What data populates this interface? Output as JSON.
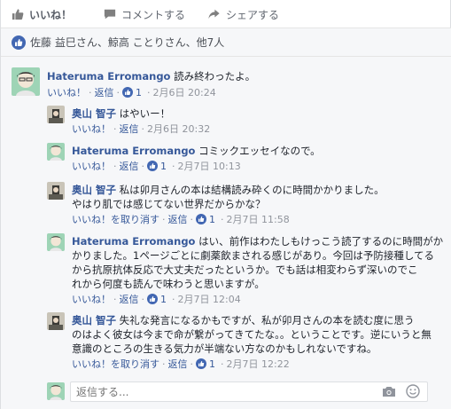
{
  "actions": {
    "like_label": "いいね！",
    "comment_label": "コメントする",
    "share_label": "シェアする"
  },
  "summary": {
    "text": "佐藤 益巳さん、鯨高 ことりさん、他7人"
  },
  "comments": [
    {
      "author": "Hateruma Erromango",
      "text": "読み終わったよ。",
      "like_label": "いいね！",
      "reply_label": "返信",
      "like_count": "1",
      "time": "2月6日 20:24"
    },
    {
      "author": "奥山 智子",
      "text": "はやいー！",
      "like_label": "いいね！",
      "reply_label": "返信",
      "time": "2月6日 20:32"
    },
    {
      "author": "Hateruma Erromango",
      "text": "コミックエッセイなので。",
      "like_label": "いいね！",
      "reply_label": "返信",
      "like_count": "1",
      "time": "2月7日 10:13"
    },
    {
      "author": "奥山 智子",
      "text_line1": "私は卯月さんの本は結構読み砕くのに時間かかりました。",
      "text_line2": "やはり肌では感じてない世界だからかな？",
      "like_label": "いいね！を取り消す",
      "reply_label": "返信",
      "like_count": "1",
      "time": "2月7日 11:58"
    },
    {
      "author": "Hateruma Erromango",
      "text_line1": "はい、前作はわたしもけっこう読了するのに時間がか",
      "text_line2": "かりました。1ページごとに劇薬飲まされる感じがあり。今回は予防接種してる",
      "text_line3": "から抗原抗体反応で大丈夫だったというか。でも話は相変わらず深いのでこ",
      "text_line4": "れから何度も読んで味わうと思いますが。",
      "like_label": "いいね！",
      "reply_label": "返信",
      "like_count": "1",
      "time": "2月7日 12:04"
    },
    {
      "author": "奥山 智子",
      "text_line1": "失礼な発言になるかもですが、私が卯月さんの本を読む度に思う",
      "text_line2": "のはよく彼女は今まで命が繋がってきてたな。。ということです。逆にいうと無",
      "text_line3": "意識のところの生きる気力が半端ない方なのかもしれないですね。",
      "like_label": "いいね！を取り消す",
      "reply_label": "返信",
      "like_count": "1",
      "time": "2月7日 12:22"
    }
  ],
  "reply_input": {
    "placeholder": "返信する..."
  },
  "colors": {
    "link": "#365899",
    "like_blue": "#4267b2",
    "meta_gray": "#90949c",
    "panel_bg": "#f6f7f9"
  },
  "icons": [
    "thumbs-up-icon",
    "comment-icon",
    "share-icon",
    "like-badge-icon",
    "camera-icon",
    "smiley-icon"
  ]
}
